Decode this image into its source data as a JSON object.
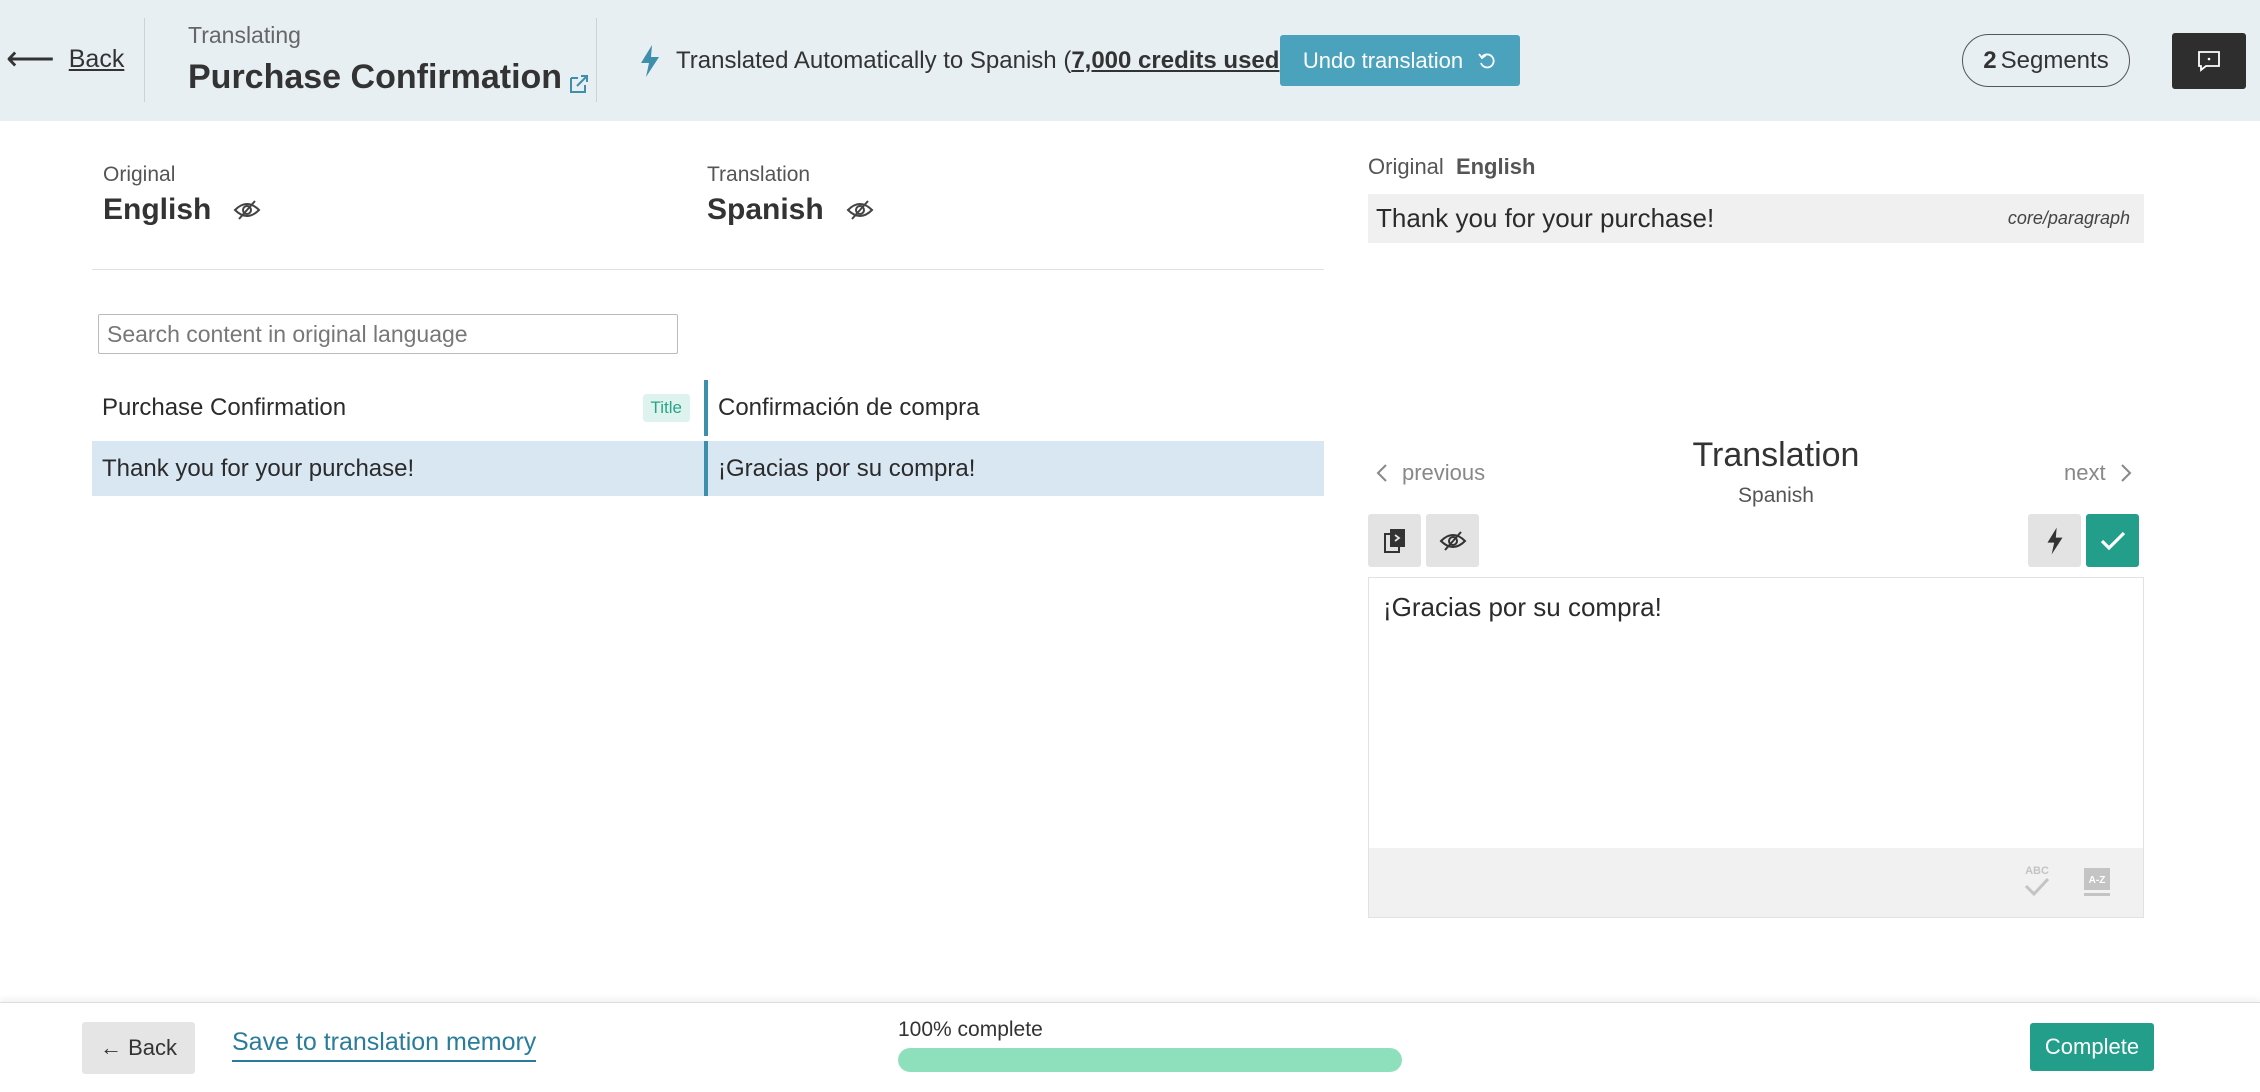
{
  "header": {
    "back_arrow": "⟵",
    "back_label": "Back",
    "translating_label": "Translating",
    "page_title": "Purchase Confirmation",
    "auto_prefix": "Translated Automatically to Spanish (",
    "auto_credits": "7,000 credits used",
    "auto_suffix": ")",
    "undo_label": "Undo translation",
    "segments_count": "2",
    "segments_label": "Segments"
  },
  "columns": {
    "original_small": "Original",
    "original_lang": "English",
    "translation_small": "Translation",
    "translation_lang": "Spanish"
  },
  "search": {
    "placeholder": "Search content in original language"
  },
  "segments": [
    {
      "original": "Purchase Confirmation",
      "badge": "Title",
      "translation": "Confirmación de compra"
    },
    {
      "original": "Thank you for your purchase!",
      "badge": "",
      "translation": "¡Gracias por su compra!"
    }
  ],
  "detail": {
    "original_label": "Original",
    "original_lang": "English",
    "original_text": "Thank you for your purchase!",
    "block_type": "core/paragraph",
    "prev_label": "previous",
    "next_label": "next",
    "translation_title": "Translation",
    "translation_lang": "Spanish",
    "editor_value": "¡Gracias por su compra!"
  },
  "footer": {
    "back_label": "← Back",
    "save_memory_label": "Save to translation memory",
    "progress_label": "100% complete",
    "progress_fraction": 1.0,
    "complete_label": "Complete"
  },
  "colors": {
    "header_bg": "#e7eff2",
    "accent_blue": "#4ba2bd",
    "accent_green": "#229e8a",
    "progress_fill": "#8ee0bc",
    "active_row": "#d9e7f3"
  },
  "icons": [
    "back-arrow-icon",
    "external-link-icon",
    "bolt-icon",
    "undo-icon",
    "comment-icon",
    "eye-slash-icon",
    "chevron-left-icon",
    "chevron-right-icon",
    "copy-original-icon",
    "check-icon",
    "spellcheck-icon",
    "az-dictionary-icon"
  ]
}
